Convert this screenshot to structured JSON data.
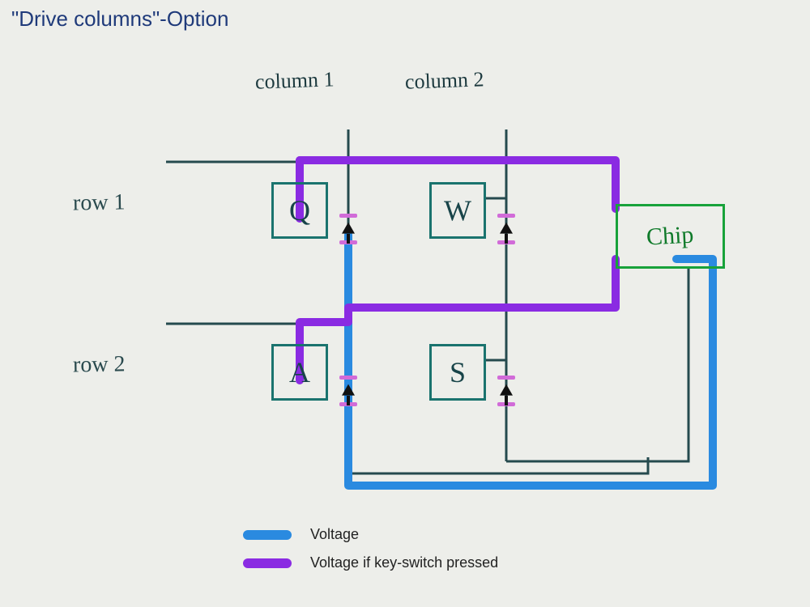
{
  "title": "\"Drive columns\"-Option",
  "columns": {
    "c1": "column 1",
    "c2": "column 2"
  },
  "rows": {
    "r1": "row 1",
    "r2": "row 2"
  },
  "keys": {
    "q": "Q",
    "w": "W",
    "a": "A",
    "s": "S"
  },
  "chip": "Chip",
  "legend": {
    "voltage": "Voltage",
    "voltage_pressed": "Voltage if key-switch pressed"
  },
  "colors": {
    "voltage": "#2a8ae0",
    "voltage_pressed": "#8a2be2",
    "pen": "#254a4e",
    "keybox": "#1a736e",
    "chipbox": "#18a23a"
  },
  "diagram": {
    "description": "2x2 keyboard matrix (Q/W on row 1, A/S on row 2, column 1 = Q/A, column 2 = W/S) connected to a scanning chip. Column 1 is driven with voltage (blue). When a key on column 1 is pressed, the voltage appears on the corresponding row line back to the chip (purple). Diodes on each switch point from column toward row.",
    "driven_column": 1,
    "keys": [
      {
        "label": "Q",
        "row": 1,
        "col": 1
      },
      {
        "label": "W",
        "row": 1,
        "col": 2
      },
      {
        "label": "A",
        "row": 2,
        "col": 1
      },
      {
        "label": "S",
        "row": 2,
        "col": 2
      }
    ],
    "row_lines_go_to": "chip (purple = sensed voltage when switch pressed)",
    "column_lines_go_to": "chip (blue = driven voltage)"
  }
}
